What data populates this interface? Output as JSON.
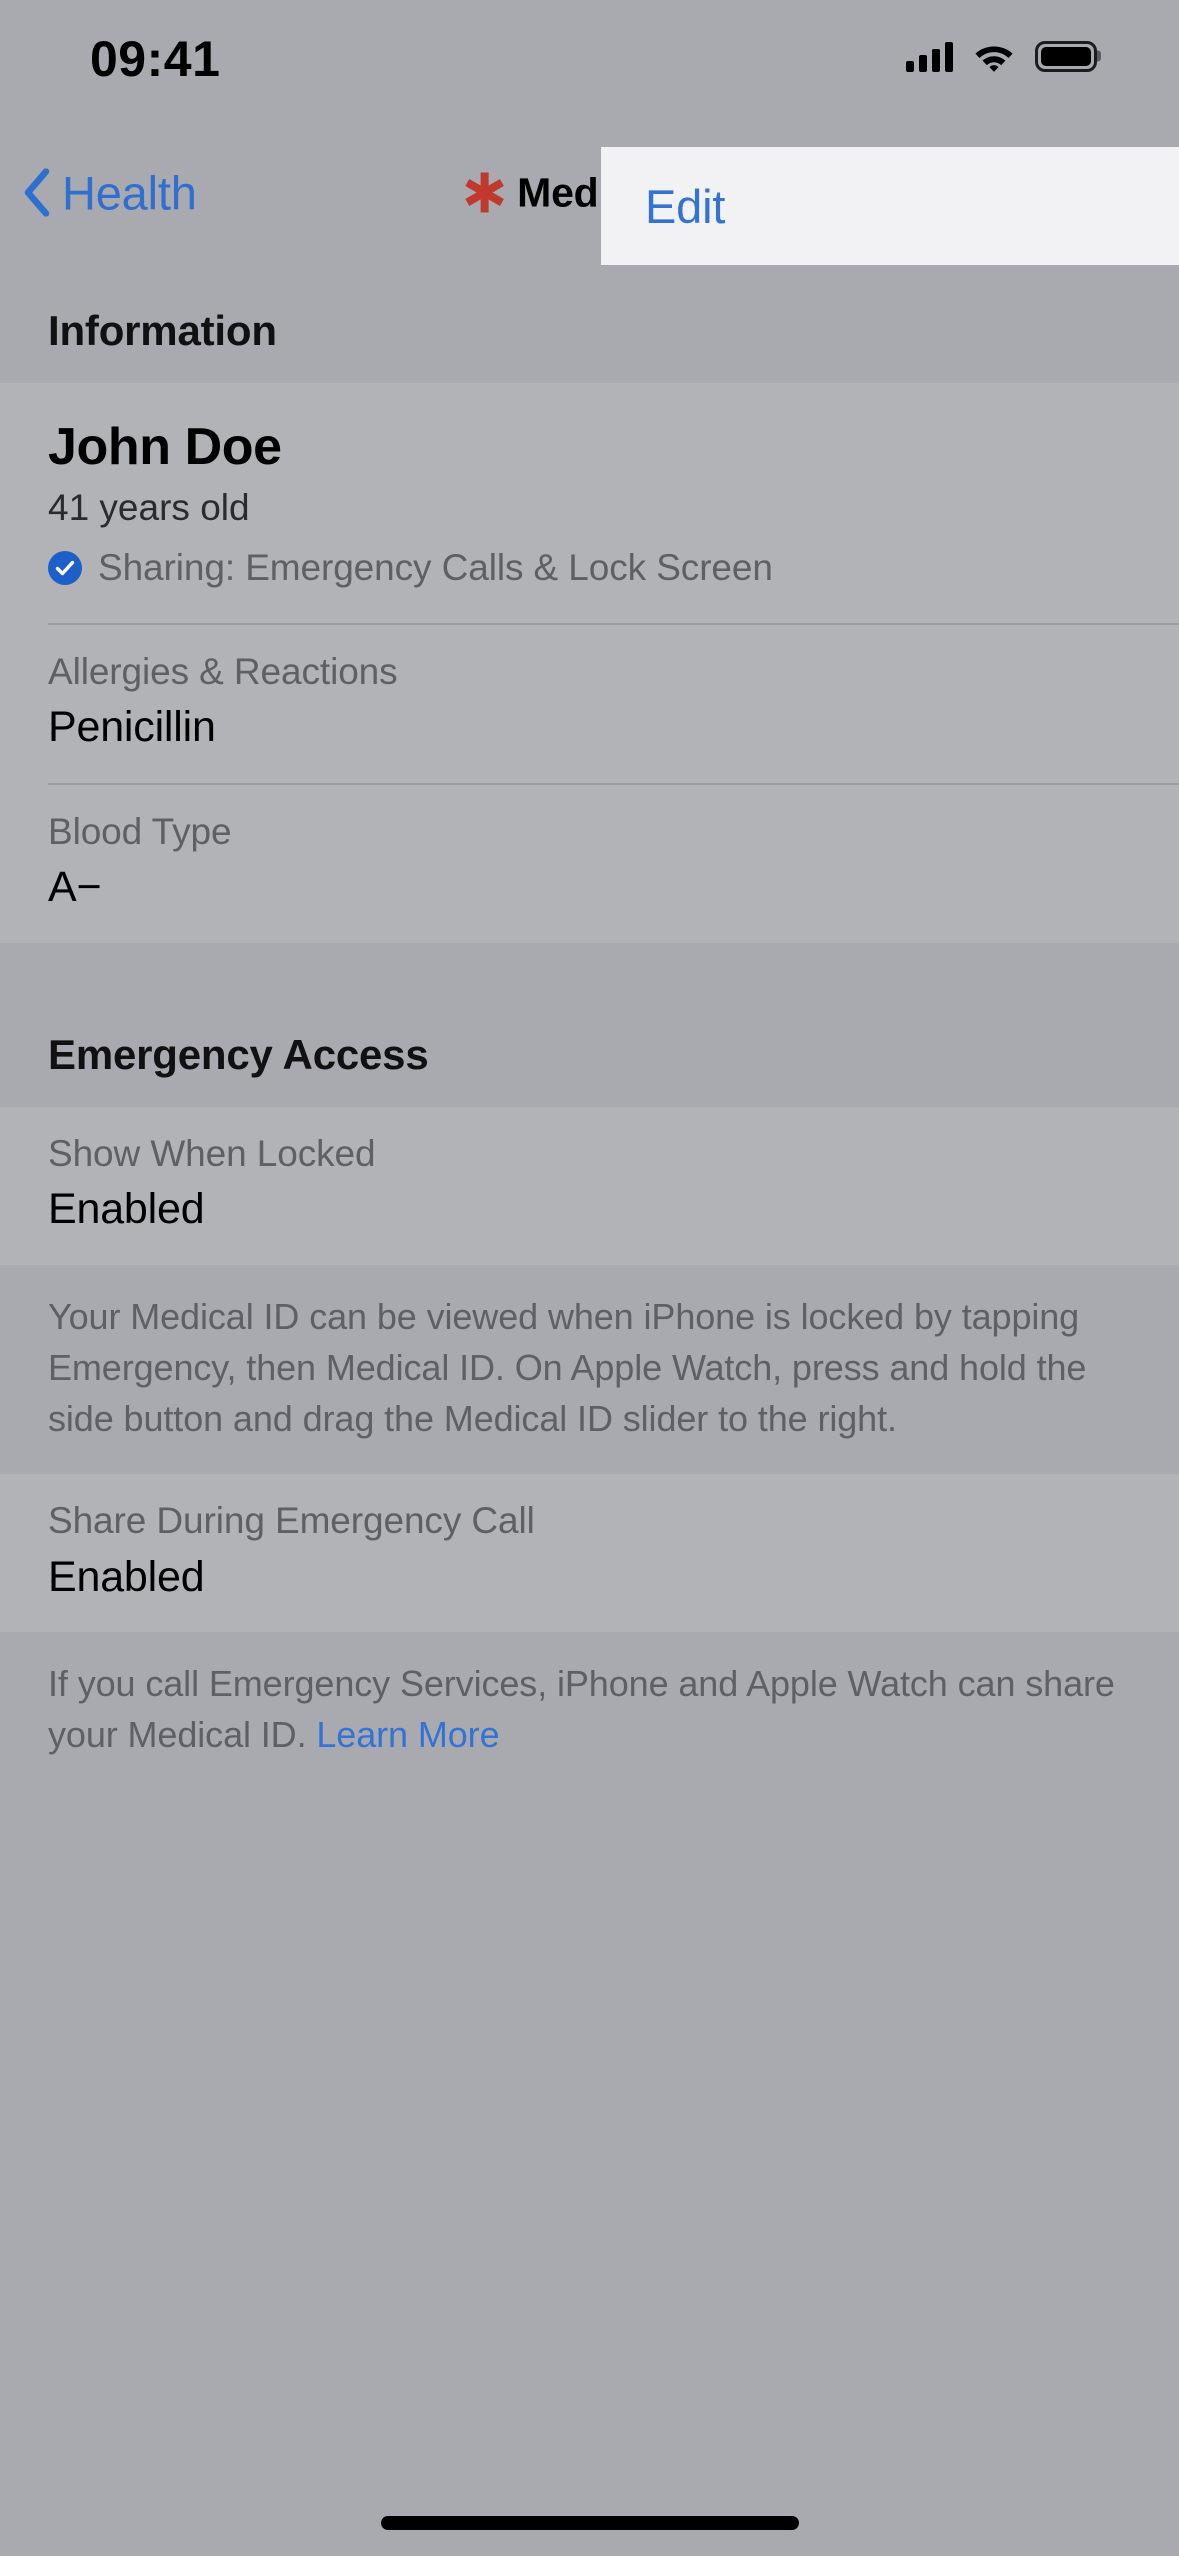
{
  "status_bar": {
    "time": "09:41",
    "cellular_icon": "cellular-signal-icon",
    "wifi_icon": "wifi-icon",
    "battery_icon": "battery-icon"
  },
  "nav": {
    "back_label": "Health",
    "back_icon": "chevron-left-icon",
    "title": "Medical ID",
    "title_icon": "medical-id-asterisk-icon",
    "edit_label": "Edit",
    "edit_highlight_color": "#f2f2f5",
    "accent_color": "#3273d4"
  },
  "information": {
    "header": "Information",
    "profile": {
      "name": "John Doe",
      "age": "41 years old",
      "sharing_badge_icon": "check-circle-icon",
      "sharing_badge_color": "#1d5fc8",
      "sharing_text": "Sharing: Emergency Calls & Lock Screen"
    },
    "rows": [
      {
        "label": "Allergies & Reactions",
        "value": "Penicillin"
      },
      {
        "label": "Blood Type",
        "value": "A−"
      }
    ]
  },
  "emergency_access": {
    "header": "Emergency Access",
    "show_when_locked": {
      "label": "Show When Locked",
      "value": "Enabled",
      "note": "Your Medical ID can be viewed when iPhone is locked by tapping Emergency, then Medical ID. On Apple Watch, press and hold the side button and drag the Medical ID slider to the right."
    },
    "share_during_call": {
      "label": "Share During Emergency Call",
      "value": "Enabled",
      "note_text": "If you call Emergency Services, iPhone and Apple Watch can share your Medical ID. ",
      "note_link": "Learn More"
    }
  },
  "home_indicator": {
    "name": "home-indicator"
  }
}
